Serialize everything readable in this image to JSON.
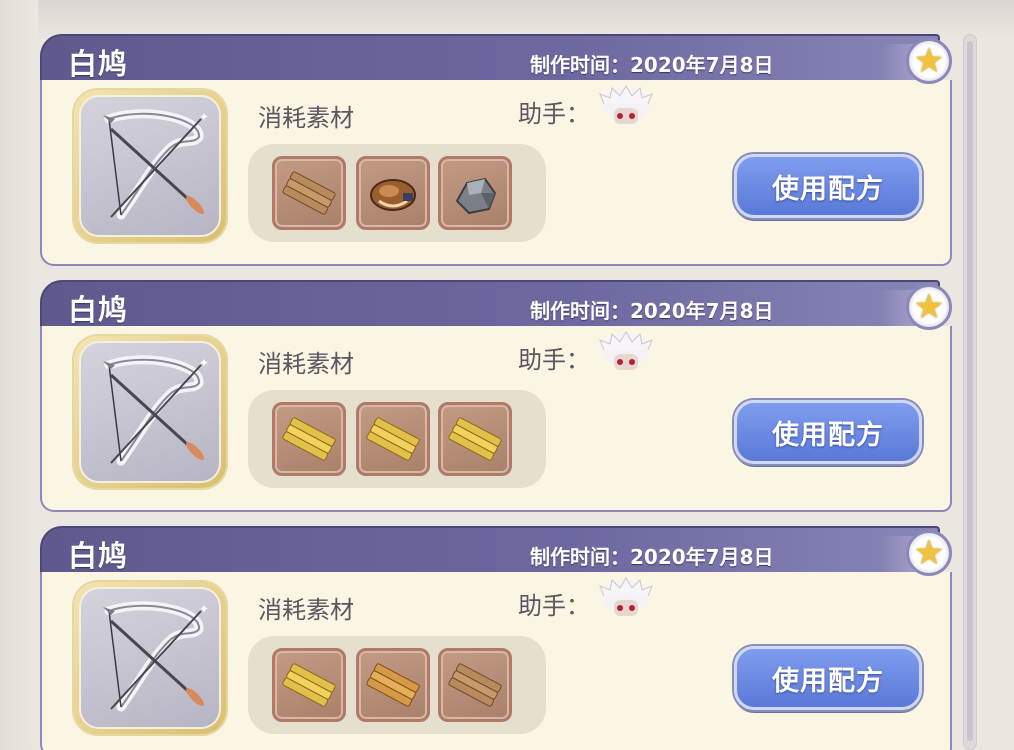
{
  "recipes": [
    {
      "title": "白鸠",
      "date": "制作时间：2020年7月8日",
      "materials_label": "消耗素材",
      "helper_label": "助手：",
      "use_button": "使用配方",
      "materials": [
        "plank-brown-icon",
        "leather-pouch-icon",
        "ore-chunk-icon"
      ]
    },
    {
      "title": "白鸠",
      "date": "制作时间：2020年7月8日",
      "materials_label": "消耗素材",
      "helper_label": "助手：",
      "use_button": "使用配方",
      "materials": [
        "plank-golden-icon",
        "plank-golden-icon",
        "plank-golden-icon"
      ]
    },
    {
      "title": "白鸠",
      "date": "制作时间：2020年7月8日",
      "materials_label": "消耗素材",
      "helper_label": "助手：",
      "use_button": "使用配方",
      "materials": [
        "plank-golden-icon",
        "plank-orange-icon",
        "plank-brown-icon"
      ]
    }
  ],
  "colors": {
    "header": "#6d69a0",
    "body": "#fbf6e4",
    "button": "#6a88e3",
    "star": "#f1c23b"
  }
}
